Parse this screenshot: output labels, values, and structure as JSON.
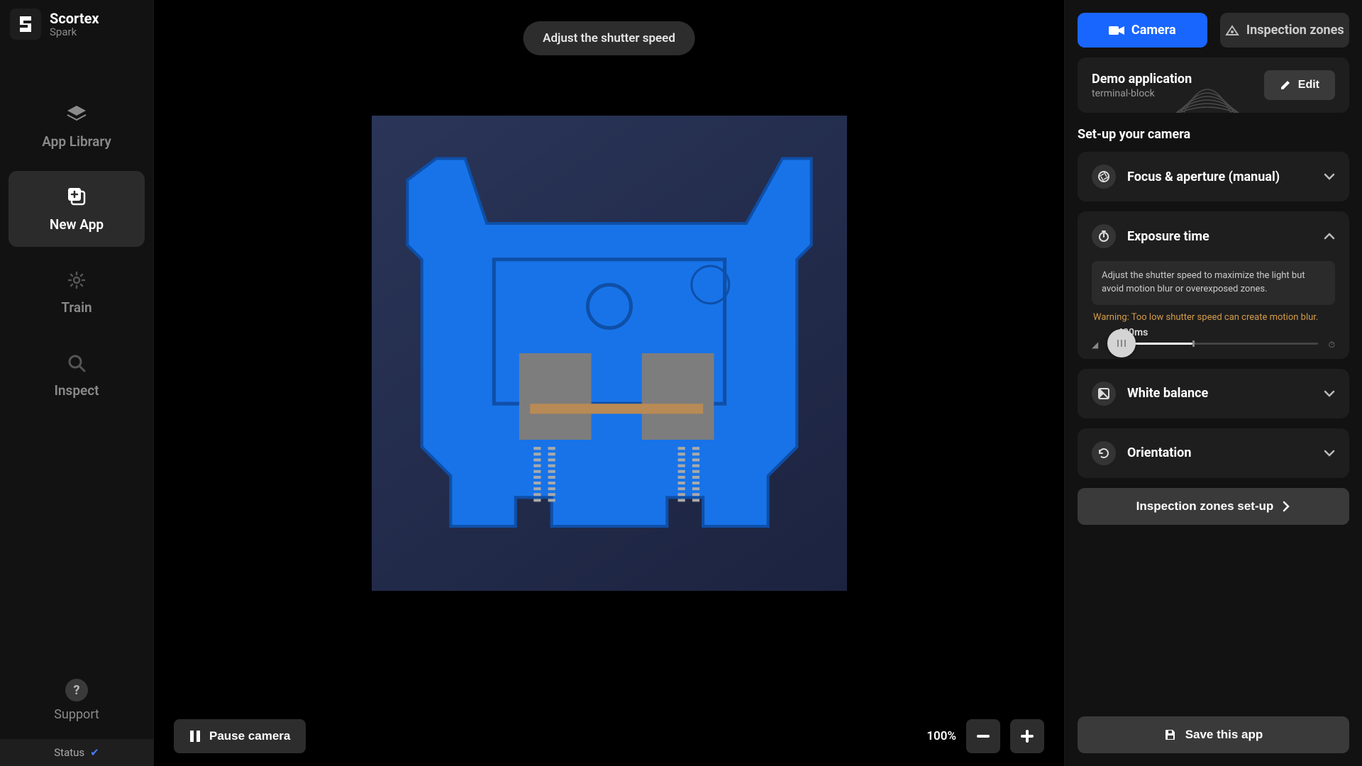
{
  "brand": {
    "title": "Scortex",
    "subtitle": "Spark"
  },
  "nav": {
    "library": "App Library",
    "new_app": "New App",
    "train": "Train",
    "inspect": "Inspect"
  },
  "support_label": "Support",
  "status_label": "Status",
  "toast": "Adjust the shutter speed",
  "bottom": {
    "pause": "Pause camera",
    "zoom": "100%"
  },
  "tabs": {
    "camera": "Camera",
    "zones": "Inspection zones"
  },
  "app_card": {
    "title": "Demo application",
    "subtitle": "terminal-block",
    "edit": "Edit"
  },
  "section_heading": "Set-up your camera",
  "accordion": {
    "focus": "Focus & aperture (manual)",
    "exposure": {
      "title": "Exposure time",
      "desc": "Adjust the shutter speed to maximize the light but avoid motion blur or overexposed zones.",
      "warning": "Warning: Too low shutter speed can create motion blur.",
      "value": "400ms",
      "min_glyph": "◢",
      "max_glyph": "⏱"
    },
    "white_balance": "White balance",
    "orientation": "Orientation"
  },
  "zones_setup": "Inspection zones set-up",
  "save": "Save this app",
  "slider": {
    "fill_pct": 40,
    "thumb_pct": 6
  },
  "colors": {
    "primary": "#1966ff",
    "warning": "#d49b4a"
  }
}
